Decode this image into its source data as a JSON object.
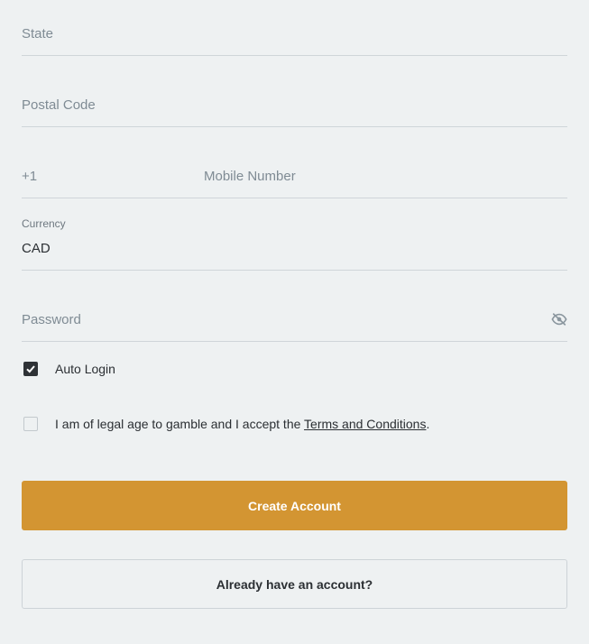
{
  "form": {
    "state": {
      "placeholder": "State"
    },
    "postal_code": {
      "placeholder": "Postal Code"
    },
    "mobile": {
      "country_code": "+1",
      "placeholder": "Mobile Number"
    },
    "currency": {
      "label": "Currency",
      "value": "CAD"
    },
    "password": {
      "placeholder": "Password",
      "toggle_icon": "eye-slash-icon"
    },
    "auto_login": {
      "label": "Auto Login",
      "checked": true
    },
    "legal_age": {
      "label_prefix": "I am of legal age to gamble and I accept the ",
      "link_text": "Terms and Conditions",
      "label_suffix": ".",
      "checked": false
    },
    "create_account_button": "Create Account",
    "have_account_button": "Already have an account?"
  },
  "colors": {
    "background": "#eef1f2",
    "primary_button": "#d39532",
    "divider": "#cfd5d9",
    "placeholder_text": "#7f8b94"
  }
}
